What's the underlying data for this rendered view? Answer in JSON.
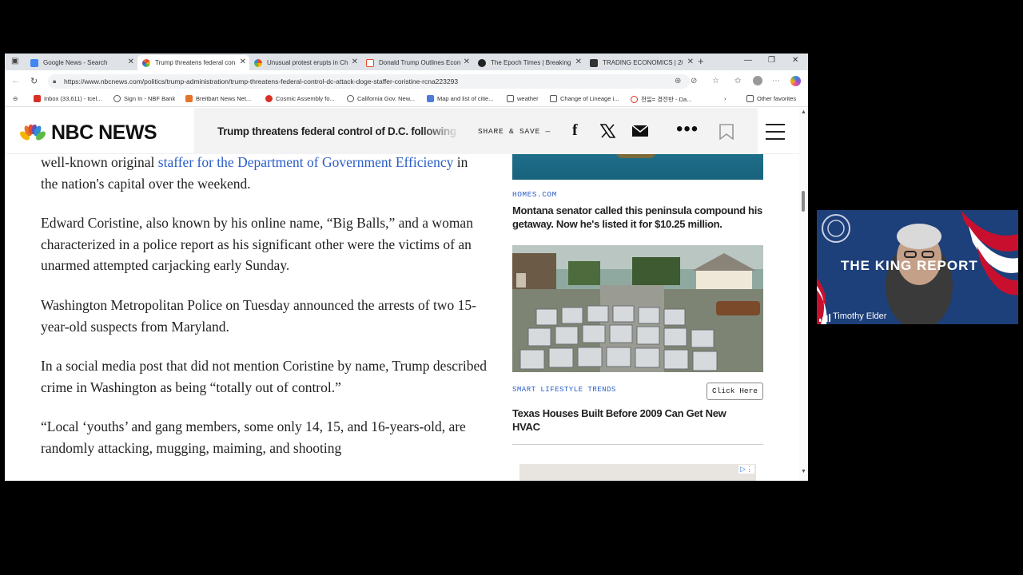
{
  "tabs": [
    {
      "title": "Google News - Search",
      "color": "#4285f4"
    },
    {
      "title": "Trump threatens federal con",
      "color": "#e8472a",
      "active": true
    },
    {
      "title": "Unusual protest erupts in Ch",
      "color": "#7a3fc4"
    },
    {
      "title": "Donald Trump Outlines Econ",
      "color": "#e8472a"
    },
    {
      "title": "The Epoch Times | Breaking",
      "color": "#222222"
    },
    {
      "title": "TRADING ECONOMICS | 20",
      "color": "#333333"
    }
  ],
  "address": {
    "url": "https://www.nbcnews.com/politics/trump-administration/trump-threatens-federal-control-dc-attack-doge-staffer-coristine-rcna223293"
  },
  "bookmarks": [
    "Inbox (33,611) - tcel...",
    "Sign In - NBF Bank",
    "Breitbart News Net...",
    "Cosmic Assembly fo...",
    "California Gov. New...",
    "Map and list of citie...",
    "weather",
    "Change of Lineage i...",
    "천일= 경전반 - Da...",
    "Other favorites"
  ],
  "header": {
    "brand": "NBC NEWS",
    "title": "Trump threatens federal control of D.C. following",
    "share": "SHARE & SAVE —"
  },
  "article": {
    "p1_a": "well-known original ",
    "p1_link": "staffer for the Department of Government Efficiency",
    "p1_b": " in the nation's capital over the weekend.",
    "p2": "Edward Coristine, also known by his online name, “Big Balls,” and a woman characterized in a police report as his significant other were the victims of an unarmed attempted carjacking early Sunday.",
    "p3": "Washington Metropolitan Police on Tuesday announced the arrests of two 15-year-old suspects from Maryland.",
    "p4": "In a social media post that did not mention Coristine by name, Trump described crime in Washington as being “totally out of control.”",
    "p5": "“Local ‘youths’ and gang members, some only 14, 15, and 16-years-old, are randomly attacking, mugging, maiming, and shooting"
  },
  "sidebar": {
    "ad1_source": "HOMES.COM",
    "ad1_title": "Montana senator called this peninsula compound his getaway. Now he's listed it for $10.25 million.",
    "ad2_source": "SMART LIFESTYLE TRENDS",
    "ad2_button": "Click Here",
    "ad2_title": "Texas Houses Built Before 2009 Can Get New HVAC"
  },
  "webcam": {
    "overlay": "THE KING REPORT",
    "name": "Timothy Elder"
  }
}
